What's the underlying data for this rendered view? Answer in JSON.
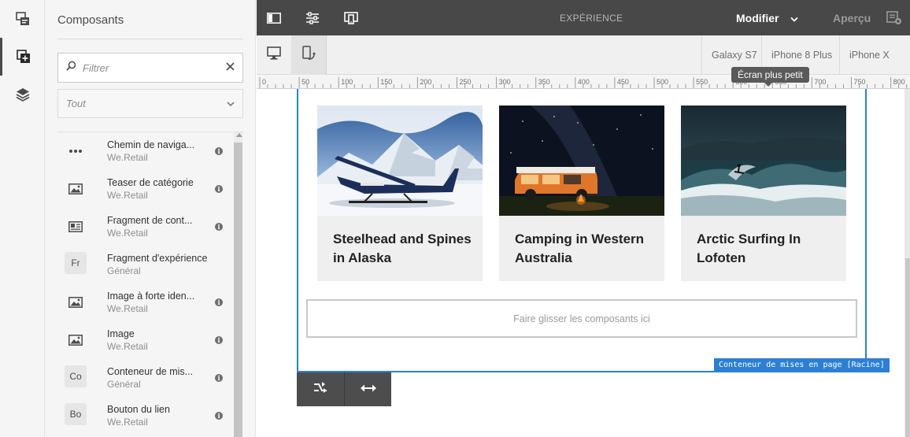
{
  "left_rail": {
    "buttons": [
      {
        "icon": "page-properties-icon"
      },
      {
        "icon": "components-icon",
        "active": true
      },
      {
        "icon": "layers-icon"
      }
    ]
  },
  "panel": {
    "title": "Composants",
    "filter_placeholder": "Filtrer",
    "group_select": "Tout",
    "items": [
      {
        "icon": "more-icon",
        "name": "Chemin de naviga...",
        "group": "We.Retail",
        "info": "i"
      },
      {
        "icon": "image-icon",
        "name": "Teaser de catégorie",
        "group": "We.Retail",
        "info": "i"
      },
      {
        "icon": "content-fragment-icon",
        "name": "Fragment de cont...",
        "group": "We.Retail",
        "info": "i"
      },
      {
        "abbr": "Fr",
        "name": "Fragment d'expérience",
        "group": "Général",
        "info": ""
      },
      {
        "icon": "image-icon",
        "name": "Image à forte iden...",
        "group": "We.Retail",
        "info": "i"
      },
      {
        "icon": "image-icon",
        "name": "Image",
        "group": "We.Retail",
        "info": "i"
      },
      {
        "abbr": "Co",
        "name": "Conteneur de mis...",
        "group": "Général",
        "info": "i"
      },
      {
        "abbr": "Bo",
        "name": "Bouton du lien",
        "group": "We.Retail",
        "info": "i"
      }
    ]
  },
  "topbar": {
    "mode_label": "EXPÉRIENCE",
    "modify_label": "Modifier",
    "preview_label": "Aperçu"
  },
  "emulator": {
    "devices": [
      "Galaxy S7",
      "iPhone 8 Plus",
      "iPhone X"
    ],
    "tooltip": "Écran plus petit"
  },
  "ruler": {
    "labels": [
      "0",
      "50",
      "100",
      "150",
      "200",
      "250",
      "300",
      "350",
      "400",
      "450",
      "500",
      "550",
      "600",
      "650",
      "700",
      "750",
      "800"
    ]
  },
  "cards": [
    {
      "title": "Steelhead and Spines in Alaska",
      "image": "seaplane-on-snow"
    },
    {
      "title": "Camping in Western Australia",
      "image": "camper-van-night"
    },
    {
      "title": "Arctic Surfing In Lofoten",
      "image": "surfer-wave"
    }
  ],
  "dropzone_text": "Faire glisser les composants ici",
  "container_label": "Conteneur de mises en page [Racine]",
  "colors": {
    "topbar": "#484848",
    "accent": "#2d7fd3",
    "panel_bg": "#f5f5f5"
  }
}
